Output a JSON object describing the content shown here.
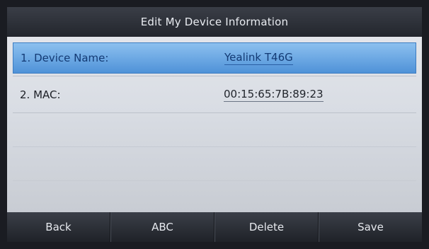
{
  "header": {
    "title": "Edit My Device Information"
  },
  "fields": [
    {
      "label": "1. Device Name:",
      "value": "Yealink T46G"
    },
    {
      "label": "2. MAC:",
      "value": "00:15:65:7B:89:23"
    }
  ],
  "softkeys": {
    "back": "Back",
    "abc": "ABC",
    "delete": "Delete",
    "save": "Save"
  }
}
